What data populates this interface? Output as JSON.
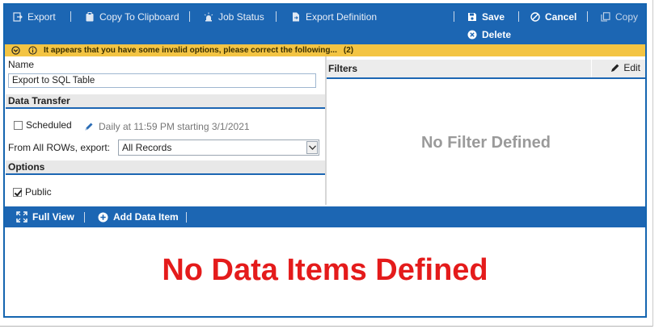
{
  "toolbar": {
    "export": "Export",
    "copy_to_clipboard": "Copy To Clipboard",
    "job_status": "Job Status",
    "export_definition": "Export Definition",
    "save": "Save",
    "cancel": "Cancel",
    "copy": "Copy",
    "delete": "Delete"
  },
  "warning": {
    "message": "It appears that you have some invalid options, please correct the following...",
    "count": "(2)"
  },
  "form": {
    "name_label": "Name",
    "name_value": "Export to SQL Table",
    "data_transfer_heading": "Data Transfer",
    "scheduled_label": "Scheduled",
    "scheduled_checked": false,
    "schedule_text": "Daily at 11:59 PM starting 3/1/2021",
    "export_label": "From All ROWs, export:",
    "export_selected": "All Records",
    "options_heading": "Options",
    "public_label": "Public",
    "public_checked": true
  },
  "filters": {
    "title": "Filters",
    "edit_label": "Edit",
    "empty_text": "No Filter Defined"
  },
  "data_items": {
    "full_view": "Full View",
    "add_data_item": "Add Data Item",
    "empty_text": "No Data Items Defined"
  },
  "colors": {
    "toolbar_blue": "#1c66b3",
    "warning_yellow": "#f3c443",
    "empty_red": "#e41b1b"
  }
}
